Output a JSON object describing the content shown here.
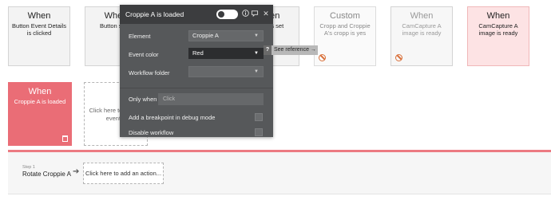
{
  "cards": [
    {
      "title": "When",
      "subtitle": "Button Event Details is clicked"
    },
    {
      "title": "When",
      "subtitle": "Button send"
    },
    {
      "title": "When",
      "subtitle": "photo is set"
    },
    {
      "title": "Custom",
      "subtitle": "Cropp and Croppie A's cropp is yes"
    },
    {
      "title": "When",
      "subtitle": "CamCapture A image is ready"
    },
    {
      "title": "When",
      "subtitle": "CamCapture A image is ready"
    }
  ],
  "active_card": {
    "title": "When",
    "subtitle": "Croppie A is loaded"
  },
  "add_event": {
    "text": "Click here to add an event..."
  },
  "step": {
    "label": "Step 1",
    "name": "Rotate Croppie A",
    "add_action": "Click here to add an action..."
  },
  "panel": {
    "title": "Croppie A is loaded",
    "element_label": "Element",
    "element_value": "Croppie A",
    "event_color_label": "Event color",
    "event_color_value": "Red",
    "workflow_folder_label": "Workflow folder",
    "workflow_folder_value": "",
    "only_when_label": "Only when",
    "only_when_placeholder": "Click",
    "breakpoint_label": "Add a breakpoint in debug mode",
    "disable_label": "Disable workflow",
    "icons": [
      "toggle-switch",
      "info-icon",
      "comment-icon",
      "close-icon"
    ]
  },
  "see_reference": "See reference →",
  "colors": {
    "accent_red": "#ea6d76",
    "panel_bg": "#56585a",
    "panel_header": "#3c3d3f"
  }
}
